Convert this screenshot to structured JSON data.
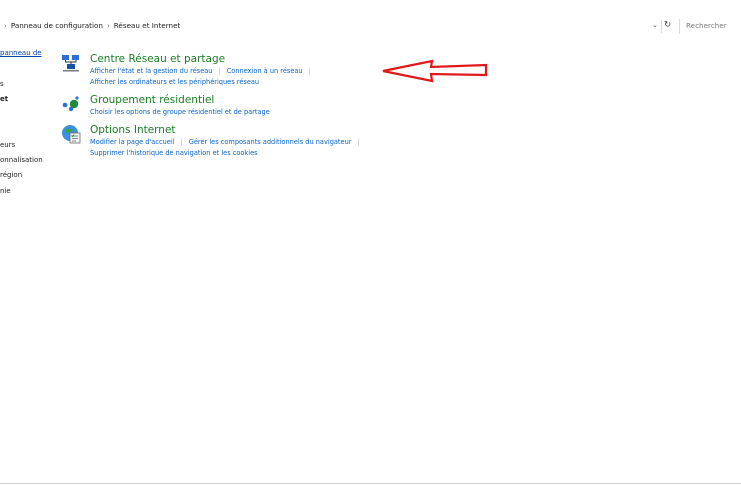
{
  "breadcrumb": {
    "items": [
      "Panneau de configuration",
      "Réseau et Internet"
    ],
    "separator": "›"
  },
  "address_tools": {
    "dropdown_icon": "chevron-down-icon",
    "refresh_icon": "refresh-icon"
  },
  "search": {
    "placeholder": "Rechercher"
  },
  "nav": {
    "home_link": "panneau de",
    "items": [
      "s",
      "et",
      "eurs",
      "onnalisation",
      "région",
      "nie"
    ]
  },
  "categories": [
    {
      "icon": "network-sharing-icon",
      "title": "Centre Réseau et partage",
      "row1": [
        "Afficher l'état et la gestion du réseau",
        "Connexion à un réseau"
      ],
      "row2": [
        "Afficher les ordinateurs et les périphériques réseau"
      ]
    },
    {
      "icon": "homegroup-icon",
      "title": "Groupement résidentiel",
      "row1": [
        "Choisir les options de groupe résidentiel et de partage"
      ]
    },
    {
      "icon": "internet-options-icon",
      "title": "Options Internet",
      "row1": [
        "Modifier la page d'accueil",
        "Gérer les composants additionnels du navigateur"
      ],
      "row2": [
        "Supprimer l'historique de navigation et les cookies"
      ]
    }
  ],
  "colors": {
    "accent_title": "#1b7d26",
    "link": "#0a63c9",
    "annotation_arrow": "#e01818"
  }
}
